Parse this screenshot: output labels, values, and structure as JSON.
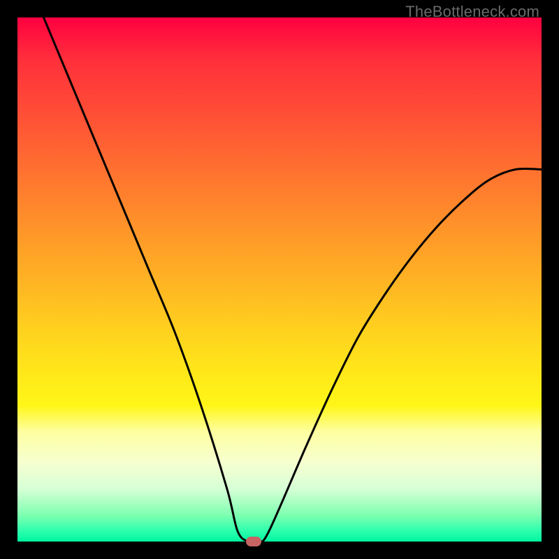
{
  "watermark": "TheBottleneck.com",
  "chart_data": {
    "type": "line",
    "title": "",
    "xlabel": "",
    "ylabel": "",
    "xlim": [
      0,
      100
    ],
    "ylim": [
      0,
      100
    ],
    "grid": false,
    "series": [
      {
        "name": "curve",
        "x": [
          5,
          10,
          15,
          20,
          25,
          30,
          35,
          40,
          42,
          44,
          46,
          48,
          55,
          60,
          65,
          70,
          75,
          80,
          85,
          90,
          95,
          100
        ],
        "y": [
          100,
          88,
          76,
          64,
          52,
          40,
          26,
          10,
          2,
          0,
          0,
          2,
          18,
          29,
          39,
          47,
          54,
          60,
          65,
          69,
          71,
          71
        ]
      }
    ],
    "marker": {
      "x": 45,
      "y": 0,
      "color": "#c86464"
    },
    "background_gradient": {
      "top": "#ff0040",
      "mid": "#ffe81a",
      "bottom": "#00f5a0"
    },
    "curve_color": "#000000"
  }
}
